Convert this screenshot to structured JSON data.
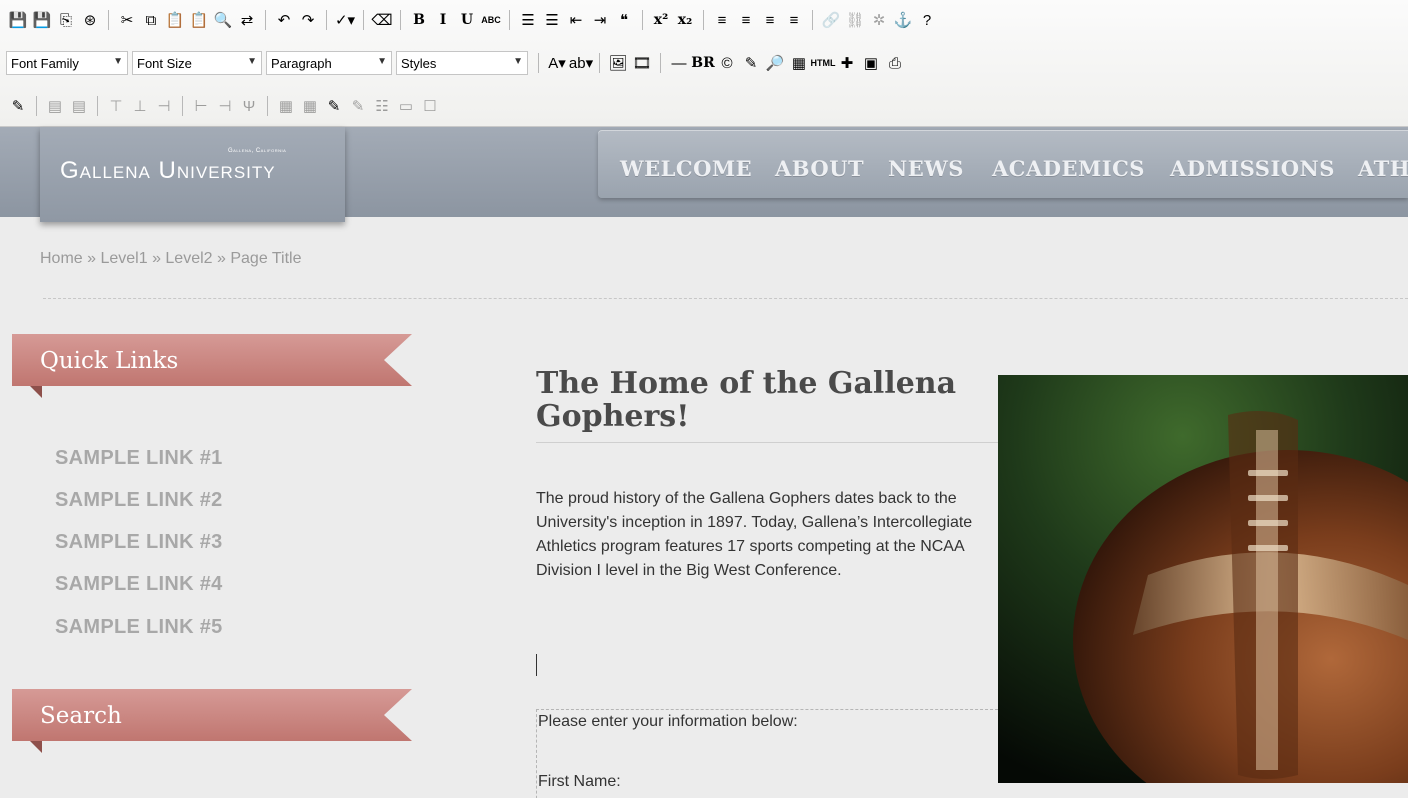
{
  "toolbar": {
    "row1": [
      {
        "icon": "save-icon",
        "glyph": "💾"
      },
      {
        "icon": "save-as-icon",
        "glyph": "💾"
      },
      {
        "icon": "template-icon",
        "glyph": "⎘"
      },
      {
        "icon": "help-lifebuoy-icon",
        "glyph": "⊛"
      },
      {
        "icon": "separator"
      },
      {
        "icon": "cut-icon",
        "glyph": "✂"
      },
      {
        "icon": "copy-icon",
        "glyph": "⧉"
      },
      {
        "icon": "paste-icon",
        "glyph": "📋"
      },
      {
        "icon": "paste-text-icon",
        "glyph": "📋"
      },
      {
        "icon": "find-icon",
        "glyph": "🔍"
      },
      {
        "icon": "replace-icon",
        "glyph": "⇄"
      },
      {
        "icon": "separator"
      },
      {
        "icon": "undo-icon",
        "glyph": "↶"
      },
      {
        "icon": "redo-icon",
        "glyph": "↷"
      },
      {
        "icon": "separator"
      },
      {
        "icon": "spellcheck-icon",
        "glyph": "✓▾"
      },
      {
        "icon": "separator"
      },
      {
        "icon": "eraser-icon",
        "glyph": "⌫"
      },
      {
        "icon": "separator"
      },
      {
        "icon": "bold-icon",
        "text": "B"
      },
      {
        "icon": "italic-icon",
        "text": "I"
      },
      {
        "icon": "underline-icon",
        "text": "U"
      },
      {
        "icon": "strikethrough-icon",
        "text": "ABC"
      },
      {
        "icon": "separator"
      },
      {
        "icon": "bullet-list-icon",
        "glyph": "☰"
      },
      {
        "icon": "numbered-list-icon",
        "glyph": "☰"
      },
      {
        "icon": "outdent-icon",
        "glyph": "⇤"
      },
      {
        "icon": "indent-icon",
        "glyph": "⇥"
      },
      {
        "icon": "blockquote-icon",
        "glyph": "❝"
      },
      {
        "icon": "separator"
      },
      {
        "icon": "superscript-icon",
        "text": "x²"
      },
      {
        "icon": "subscript-icon",
        "text": "x₂"
      },
      {
        "icon": "separator"
      },
      {
        "icon": "align-left-icon",
        "glyph": "≡"
      },
      {
        "icon": "align-center-icon",
        "glyph": "≡"
      },
      {
        "icon": "align-right-icon",
        "glyph": "≡"
      },
      {
        "icon": "align-justify-icon",
        "glyph": "≡"
      },
      {
        "icon": "separator"
      },
      {
        "icon": "link-icon",
        "glyph": "🔗",
        "disabled": true
      },
      {
        "icon": "unlink-icon",
        "glyph": "⛓",
        "disabled": true
      },
      {
        "icon": "cleanup-icon",
        "glyph": "✲",
        "disabled": true
      },
      {
        "icon": "anchor-icon",
        "glyph": "⚓"
      },
      {
        "icon": "help-icon",
        "glyph": "?"
      }
    ],
    "font_family": "Font Family",
    "font_size": "Font Size",
    "paragraph": "Paragraph",
    "styles": "Styles",
    "row2": [
      {
        "icon": "text-color-icon",
        "glyph": "A▾"
      },
      {
        "icon": "highlight-color-icon",
        "glyph": "ab▾"
      },
      {
        "icon": "separator"
      },
      {
        "icon": "image-icon",
        "glyph": "🖼"
      },
      {
        "icon": "media-icon",
        "glyph": "🎞"
      },
      {
        "icon": "separator"
      },
      {
        "icon": "horizontal-rule-icon",
        "glyph": "—"
      },
      {
        "icon": "line-break-icon",
        "text": "BR"
      },
      {
        "icon": "copyright-icon",
        "glyph": "©"
      },
      {
        "icon": "clean-format-icon",
        "glyph": "✎"
      },
      {
        "icon": "preview-icon",
        "glyph": "🔎"
      },
      {
        "icon": "table-icon",
        "glyph": "▦"
      },
      {
        "icon": "html-icon",
        "text": "HTML"
      },
      {
        "icon": "plugin-icon",
        "glyph": "✚"
      },
      {
        "icon": "template-window-icon",
        "glyph": "▣"
      },
      {
        "icon": "print-icon",
        "glyph": "⎙"
      }
    ],
    "row3": [
      {
        "icon": "edit-cell-icon",
        "glyph": "✎"
      },
      {
        "icon": "separator"
      },
      {
        "icon": "table-props-icon",
        "glyph": "▤",
        "disabled": true
      },
      {
        "icon": "cell-props-icon",
        "glyph": "▤",
        "disabled": true
      },
      {
        "icon": "separator"
      },
      {
        "icon": "insert-row-before-icon",
        "glyph": "⊤",
        "disabled": true
      },
      {
        "icon": "insert-row-after-icon",
        "glyph": "⊥",
        "disabled": true
      },
      {
        "icon": "delete-row-icon",
        "glyph": "⊣",
        "disabled": true
      },
      {
        "icon": "separator"
      },
      {
        "icon": "insert-col-before-icon",
        "glyph": "⊢",
        "disabled": true
      },
      {
        "icon": "insert-col-after-icon",
        "glyph": "⊣",
        "disabled": true
      },
      {
        "icon": "delete-col-icon",
        "glyph": "Ψ",
        "disabled": true
      },
      {
        "icon": "separator"
      },
      {
        "icon": "split-cell-icon",
        "glyph": "▦",
        "disabled": true
      },
      {
        "icon": "merge-cell-icon",
        "glyph": "▦",
        "disabled": true
      },
      {
        "icon": "edit-table-icon",
        "glyph": "✎"
      },
      {
        "icon": "delete-table-icon",
        "glyph": "✎",
        "disabled": true
      },
      {
        "icon": "layer-icon",
        "glyph": "☷",
        "disabled": true
      },
      {
        "icon": "box-icon",
        "glyph": "▭",
        "disabled": true
      },
      {
        "icon": "frame-icon",
        "glyph": "☐",
        "disabled": true
      }
    ]
  },
  "header": {
    "logo_name_first": "Gallena",
    "logo_name_second": "University",
    "logo_tagline": "Gallena, California",
    "nav": [
      "WELCOME",
      "ABOUT",
      "NEWS",
      "ACADEMICS",
      "ADMISSIONS",
      "ATHLETICS"
    ]
  },
  "breadcrumb": "Home » Level1 » Level2 » Page Title",
  "sidebar": {
    "quick_links_title": "Quick Links",
    "links": [
      "SAMPLE LINK #1",
      "SAMPLE LINK #2",
      "SAMPLE LINK #3",
      "SAMPLE LINK #4",
      "SAMPLE LINK #5"
    ],
    "search_title": "Search"
  },
  "main": {
    "title": "The Home of the Gallena Gophers!",
    "paragraph": "The proud history of the Gallena Gophers dates back to the University's inception in 1897. Today, Gallena’s Intercollegiate Athletics program features 17 sports competing at the NCAA Division I level in the Big West Conference.",
    "form_intro": "Please enter your information below:",
    "first_name_label": "First Name:"
  },
  "colors": {
    "ribbon": "#c9827d",
    "header": "#97a0ac",
    "link_gray": "#a8a8a8"
  }
}
